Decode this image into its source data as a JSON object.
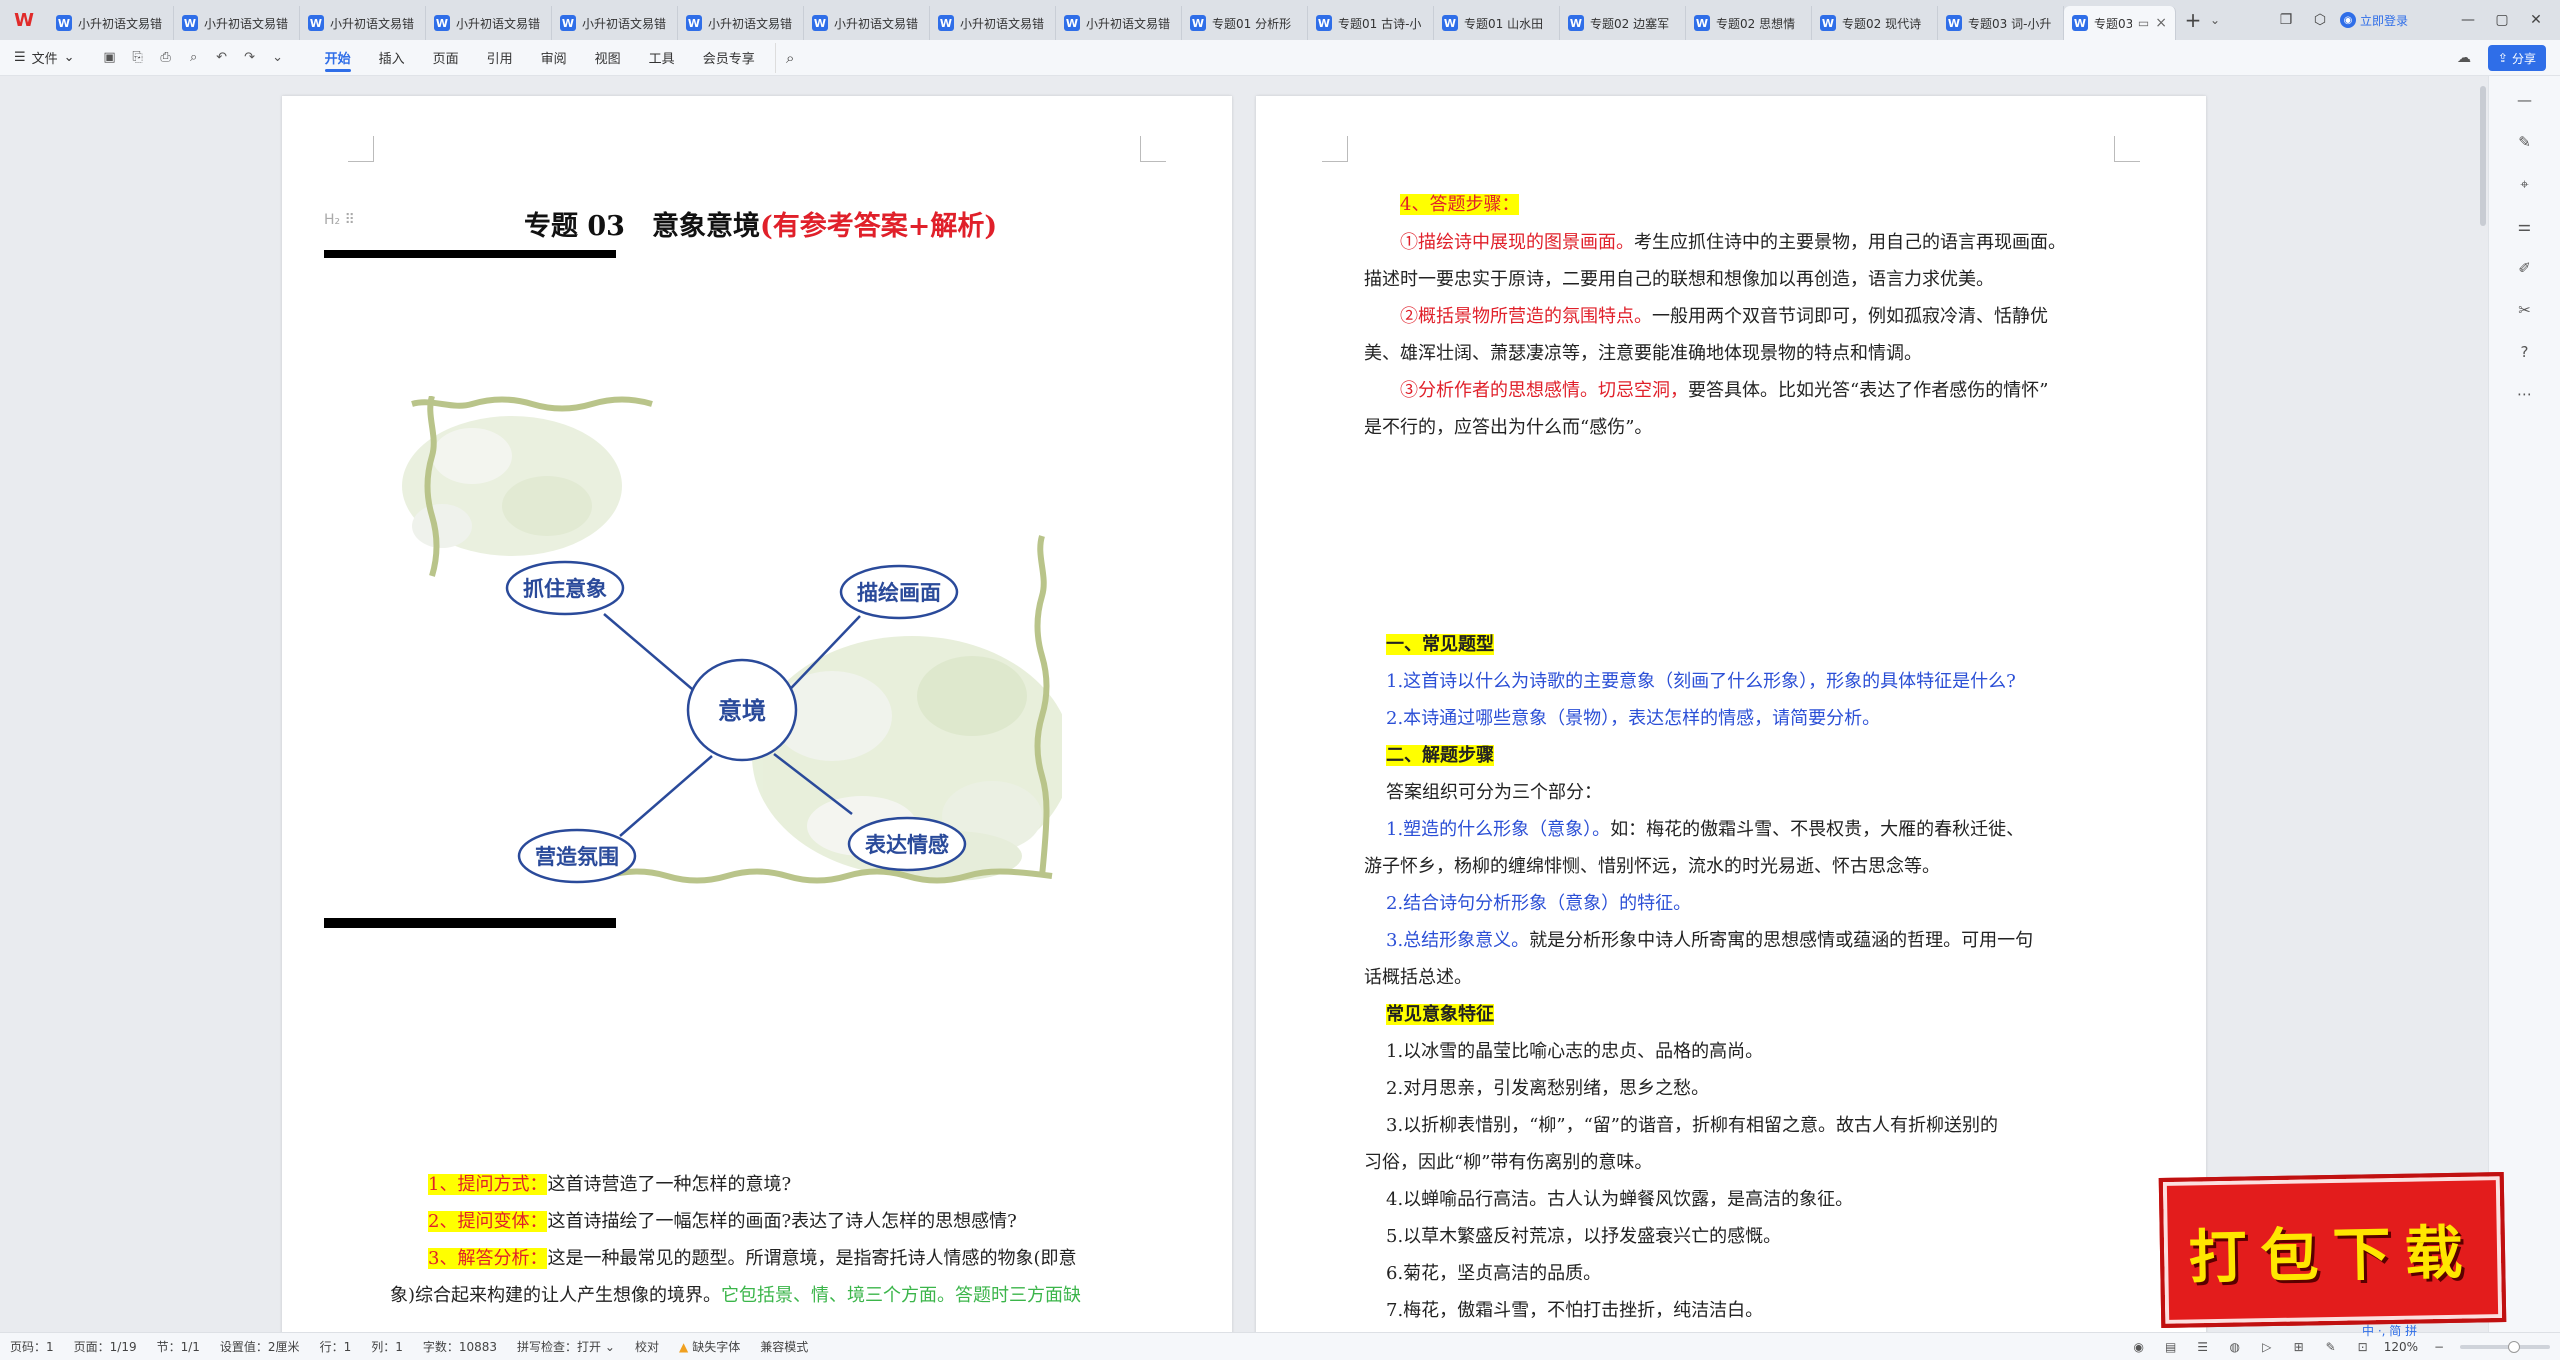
{
  "app": {
    "logo": "W"
  },
  "tabs": [
    {
      "label": "小升初语文易错"
    },
    {
      "label": "小升初语文易错"
    },
    {
      "label": "小升初语文易错"
    },
    {
      "label": "小升初语文易错"
    },
    {
      "label": "小升初语文易错"
    },
    {
      "label": "小升初语文易错"
    },
    {
      "label": "小升初语文易错"
    },
    {
      "label": "小升初语文易错"
    },
    {
      "label": "小升初语文易错"
    },
    {
      "label": "专题01 分析形"
    },
    {
      "label": "专题01 古诗-小"
    },
    {
      "label": "专题01 山水田"
    },
    {
      "label": "专题02 边塞军"
    },
    {
      "label": "专题02 思想情"
    },
    {
      "label": "专题02 现代诗"
    },
    {
      "label": "专题03 词-小升"
    }
  ],
  "active_tab": {
    "label": "专题03",
    "close": "×",
    "monitor": "▭"
  },
  "new_tab": "+",
  "login": {
    "label": "立即登录"
  },
  "menubar": {
    "file": "文件",
    "items": [
      "开始",
      "插入",
      "页面",
      "引用",
      "审阅",
      "视图",
      "工具",
      "会员专享"
    ],
    "share": "分享"
  },
  "left_page": {
    "heading_marker": "H₂ ⠿",
    "title_main": "专题 03　意象意境",
    "title_red": "(有参考答案+解析)",
    "mindmap": {
      "center": "意境",
      "nodes": [
        "抓住意象",
        "描绘画面",
        "营造氛围",
        "表达情感"
      ]
    },
    "lines": [
      {
        "label": "1、提问方式：",
        "text": "这首诗营造了一种怎样的意境?"
      },
      {
        "label": "2、提问变体：",
        "text": "这首诗描绘了一幅怎样的画面?表达了诗人怎样的思想感情?"
      },
      {
        "label": "3、解答分析：",
        "text": "这是一种最常见的题型。所谓意境，是指寄托诗人情感的物象(即意"
      },
      {
        "text": "象)综合起来构建的让人产生想像的境界。",
        "green": "它包括景、情、境三个方面。答题时三方面缺"
      }
    ]
  },
  "right_page": {
    "step_heading": "4、答题步骤：",
    "steps": [
      {
        "red": "①描绘诗中展现的图景画面。",
        "text": "考生应抓住诗中的主要景物，用自己的语言再现画面。"
      },
      {
        "text": "描述时一要忠实于原诗，二要用自己的联想和想像加以再创造，语言力求优美。"
      },
      {
        "red": "②概括景物所营造的氛围特点。",
        "text": "一般用两个双音节词即可，例如孤寂冷清、恬静优"
      },
      {
        "text": "美、雄浑壮阔、萧瑟凄凉等，注意要能准确地体现景物的特点和情调。"
      },
      {
        "red": "③分析作者的思想感情。切忌空洞，",
        "text": "要答具体。比如光答“表达了作者感伤的情怀”"
      },
      {
        "text": "是不行的，应答出为什么而“感伤”。"
      }
    ],
    "sec1_heading": "一、常见题型",
    "sec1_items": [
      "1.这首诗以什么为诗歌的主要意象（刻画了什么形象），形象的具体特征是什么?",
      "2.本诗通过哪些意象（景物），表达怎样的情感，请简要分析。"
    ],
    "sec2_heading": "二、解题步骤",
    "sec2_intro": "答案组织可分为三个部分：",
    "sec2_items": [
      {
        "blue": "1.塑造的什么形象（意象）。",
        "text": "如：梅花的傲霜斗雪、不畏权贵，大雁的春秋迁徙、"
      },
      {
        "text": "游子怀乡，杨柳的缠绵悱恻、惜别怀远，流水的时光易逝、怀古思念等。"
      },
      {
        "blue": "2.结合诗句分析形象（意象）的特征。",
        "text": ""
      },
      {
        "blue": "3.总结形象意义。",
        "text": "就是分析形象中诗人所寄寓的思想感情或蕴涵的哲理。可用一句"
      },
      {
        "text": "话概括总述。"
      }
    ],
    "sec3_heading": "常见意象特征",
    "sec3_items": [
      "1.以冰雪的晶莹比喻心志的忠贞、品格的高尚。",
      "2.对月思亲，引发离愁别绪，思乡之愁。",
      "3.以折柳表惜别，“柳”，“留”的谐音，折柳有相留之意。故古人有折柳送别的",
      "习俗，因此“柳”带有伤离别的意味。",
      "4.以蝉喻品行高洁。古人认为蝉餐风饮露，是高洁的象征。",
      "5.以草木繁盛反衬荒凉，以抒发盛衰兴亡的感慨。",
      "6.菊花，坚贞高洁的品质。",
      "7.梅花，傲霜斗雪，不怕打击挫折，纯洁洁白。"
    ]
  },
  "statusbar": {
    "page_num": "页码：1",
    "page_count": "页面：1/19",
    "section": "节：1/1",
    "setting": "设置值：2厘米",
    "row": "行：1",
    "col": "列：1",
    "words": "字数：10883",
    "spell": "拼写检查：打开",
    "proof": "校对",
    "missing_font": "缺失字体",
    "compat": "兼容模式",
    "zoom": "120%",
    "zoom_level": 0.6
  },
  "badge": {
    "text": "打包下载"
  },
  "ime": "中 ·, 简 拼"
}
